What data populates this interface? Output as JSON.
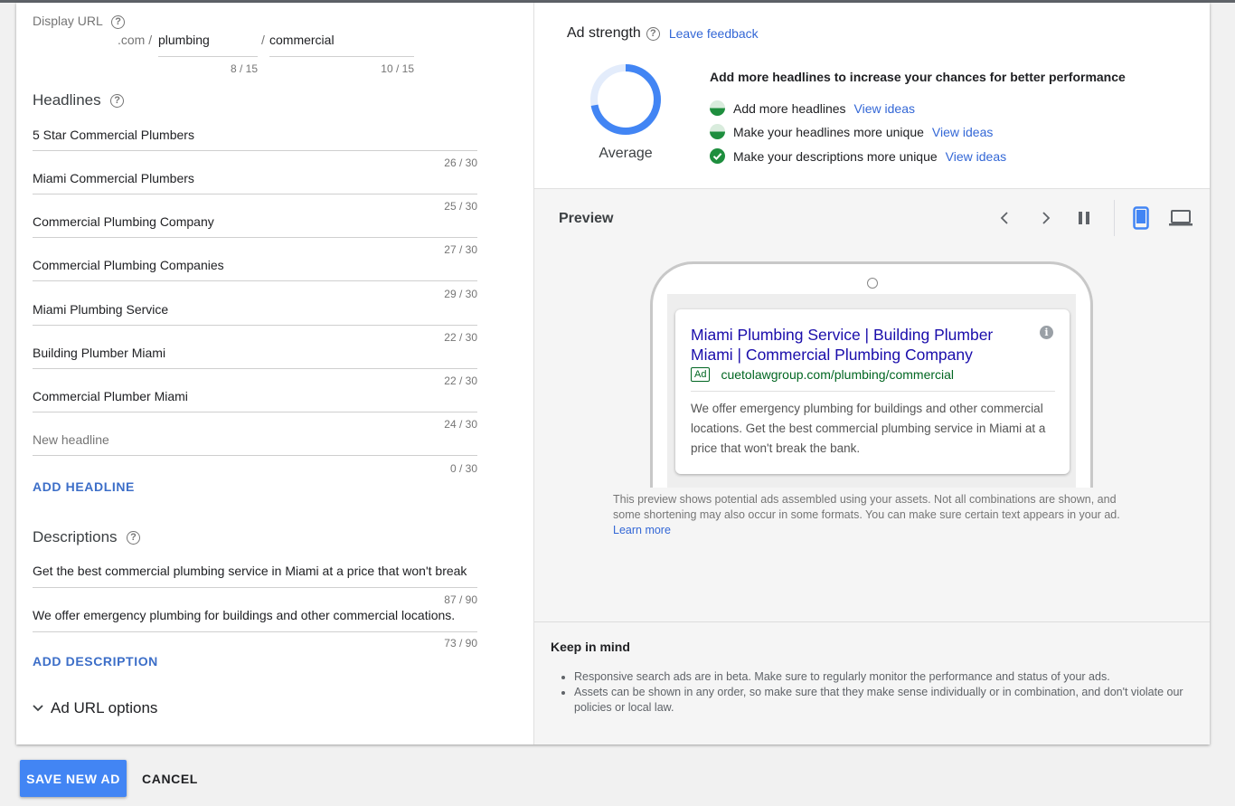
{
  "display_url": {
    "label": "Display URL",
    "domain_suffix": ".com /",
    "path1": "plumbing",
    "separator": "/",
    "path2": "commercial",
    "path1_counter": "8 / 15",
    "path2_counter": "10 / 15"
  },
  "headlines": {
    "title": "Headlines",
    "items": [
      {
        "text": "5 Star Commercial Plumbers",
        "counter": "26 / 30"
      },
      {
        "text": "Miami Commercial Plumbers",
        "counter": "25 / 30"
      },
      {
        "text": "Commercial Plumbing Company",
        "counter": "27 / 30"
      },
      {
        "text": "Commercial Plumbing Companies",
        "counter": "29 / 30"
      },
      {
        "text": "Miami Plumbing Service",
        "counter": "22 / 30"
      },
      {
        "text": "Building Plumber Miami",
        "counter": "22 / 30"
      },
      {
        "text": "Commercial Plumber Miami",
        "counter": "24 / 30"
      }
    ],
    "new_placeholder": "New headline",
    "new_counter": "0 / 30",
    "add_label": "ADD HEADLINE"
  },
  "descriptions": {
    "title": "Descriptions",
    "items": [
      {
        "text": "Get the best commercial plumbing service in Miami at a price that won't break",
        "counter": "87 / 90"
      },
      {
        "text": "We offer emergency plumbing for buildings and other commercial locations.",
        "counter": "73 / 90"
      }
    ],
    "add_label": "ADD DESCRIPTION"
  },
  "url_options": {
    "label": "Ad URL options"
  },
  "ad_strength": {
    "title": "Ad strength",
    "feedback_link": "Leave feedback",
    "rating": "Average",
    "rating_fraction": 0.72,
    "headline": "Add more headlines to increase your chances for better performance",
    "tips": [
      {
        "text": "Add more headlines",
        "link": "View ideas",
        "status": "partial"
      },
      {
        "text": "Make your headlines more unique",
        "link": "View ideas",
        "status": "partial"
      },
      {
        "text": "Make your descriptions more unique",
        "link": "View ideas",
        "status": "done"
      }
    ]
  },
  "preview": {
    "title": "Preview",
    "ad_title": "Miami Plumbing Service | Building Plumber Miami | Commercial Plumbing Company",
    "ad_badge": "Ad",
    "ad_url": "cuetolawgroup.com/plumbing/commercial",
    "ad_description": "We offer emergency plumbing for buildings and other commercial locations. Get the best commercial plumbing service in Miami at a price that won't break the bank.",
    "note": "This preview shows potential ads assembled using your assets. Not all combinations are shown, and some shortening may also occur in some formats. You can make sure certain text appears in your ad.",
    "learn_more": "Learn more"
  },
  "keep_in_mind": {
    "title": "Keep in mind",
    "bullets": [
      "Responsive search ads are in beta. Make sure to regularly monitor the performance and status of your ads.",
      "Assets can be shown in any order, so make sure that they make sense individually or in combination, and don't violate our policies or local law."
    ]
  },
  "footer": {
    "save_label": "SAVE NEW AD",
    "cancel_label": "CANCEL"
  },
  "colors": {
    "accent": "#4285f4",
    "link": "#3367d6",
    "ad_title": "#1a0dab",
    "ad_url": "#006621",
    "success": "#1e8e3e"
  },
  "help_glyph": "?"
}
